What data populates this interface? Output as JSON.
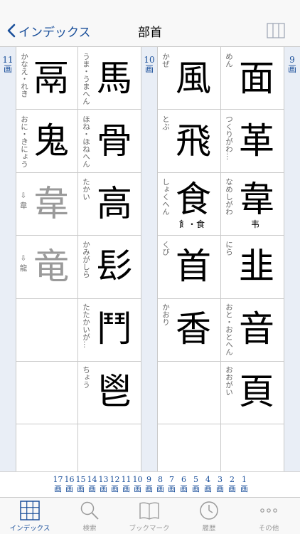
{
  "header": {
    "back_label": "インデックス",
    "title": "部首"
  },
  "stroke_groups": {
    "g11": "11\n画",
    "g10": "10\n画",
    "g9": "9\n画"
  },
  "columns": {
    "c1": [
      {
        "kanji": "鬲",
        "reading": "かなえ・れき"
      },
      {
        "kanji": "鬼",
        "reading": "おに・きにょう"
      },
      {
        "kanji": "韋",
        "ref": "⇩\n韋"
      },
      {
        "kanji": "竜",
        "ref": "⇩\n龍"
      }
    ],
    "c2": [
      {
        "kanji": "馬",
        "reading": "うま・うまへん"
      },
      {
        "kanji": "骨",
        "reading": "ほね・ほねへん"
      },
      {
        "kanji": "高",
        "reading": "たかい"
      },
      {
        "kanji": "髟",
        "reading": "かみがしら"
      },
      {
        "kanji": "鬥",
        "reading": "たたかいが…"
      },
      {
        "kanji": "鬯",
        "reading": "ちょう"
      }
    ],
    "c3": [
      {
        "kanji": "風",
        "reading": "かぜ"
      },
      {
        "kanji": "飛",
        "reading": "とぶ"
      },
      {
        "kanji": "食",
        "reading": "しょくへん",
        "variant": "飠・食"
      },
      {
        "kanji": "首",
        "reading": "くび"
      },
      {
        "kanji": "香",
        "reading": "かおり"
      }
    ],
    "c4": [
      {
        "kanji": "面",
        "reading": "めん"
      },
      {
        "kanji": "革",
        "reading": "つくりがわ…"
      },
      {
        "kanji": "韋",
        "reading": "なめしがわ",
        "variant": "韦"
      },
      {
        "kanji": "韭",
        "reading": "にら"
      },
      {
        "kanji": "音",
        "reading": "おと・おとへん"
      },
      {
        "kanji": "頁",
        "reading": "おおがい"
      }
    ]
  },
  "index_bar": [
    "17\n画",
    "16\n画",
    "15\n画",
    "14\n画",
    "13\n画",
    "12\n画",
    "11\n画",
    "10\n画",
    "9\n画",
    "8\n画",
    "7\n画",
    "6\n画",
    "5\n画",
    "4\n画",
    "3\n画",
    "2\n画",
    "1\n画"
  ],
  "tabs": [
    {
      "label": "インデックス",
      "icon": "grid-icon"
    },
    {
      "label": "検索",
      "icon": "search-icon"
    },
    {
      "label": "ブックマーク",
      "icon": "book-icon"
    },
    {
      "label": "履歴",
      "icon": "clock-icon"
    },
    {
      "label": "その他",
      "icon": "more-icon"
    }
  ],
  "colors": {
    "accent": "#1a4f9a",
    "stripe": "#e9eef6",
    "grid_line": "#c9c9c9",
    "inactive": "#9a9a9a"
  }
}
